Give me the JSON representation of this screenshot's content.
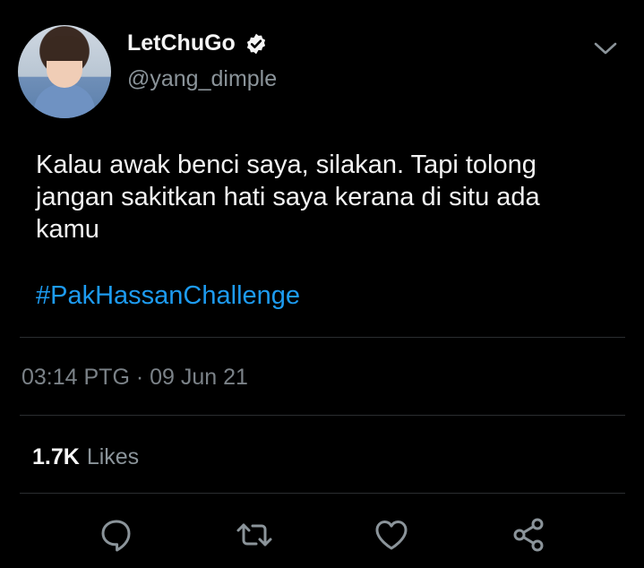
{
  "tweet": {
    "display_name": "LetChuGo",
    "handle": "@yang_dimple",
    "text_lines": [
      "Kalau awak benci saya, silakan. Tapi tolong",
      "jangan sakitkan hati saya kerana di situ ada",
      "kamu"
    ],
    "hashtag": "#PakHassanChallenge",
    "timestamp": "03:14 PTG · 09 Jun 21",
    "likes_count": "1.7K",
    "likes_label": "Likes"
  },
  "icons": {
    "verified": "verified-badge-icon",
    "menu": "chevron-down-icon",
    "reply": "reply-icon",
    "retweet": "retweet-icon",
    "like": "heart-icon",
    "share": "share-icon"
  },
  "colors": {
    "background": "#000000",
    "text": "#f2f2f2",
    "secondary": "#8b949a",
    "link": "#1d9bf0",
    "icon": "#8b949a"
  }
}
